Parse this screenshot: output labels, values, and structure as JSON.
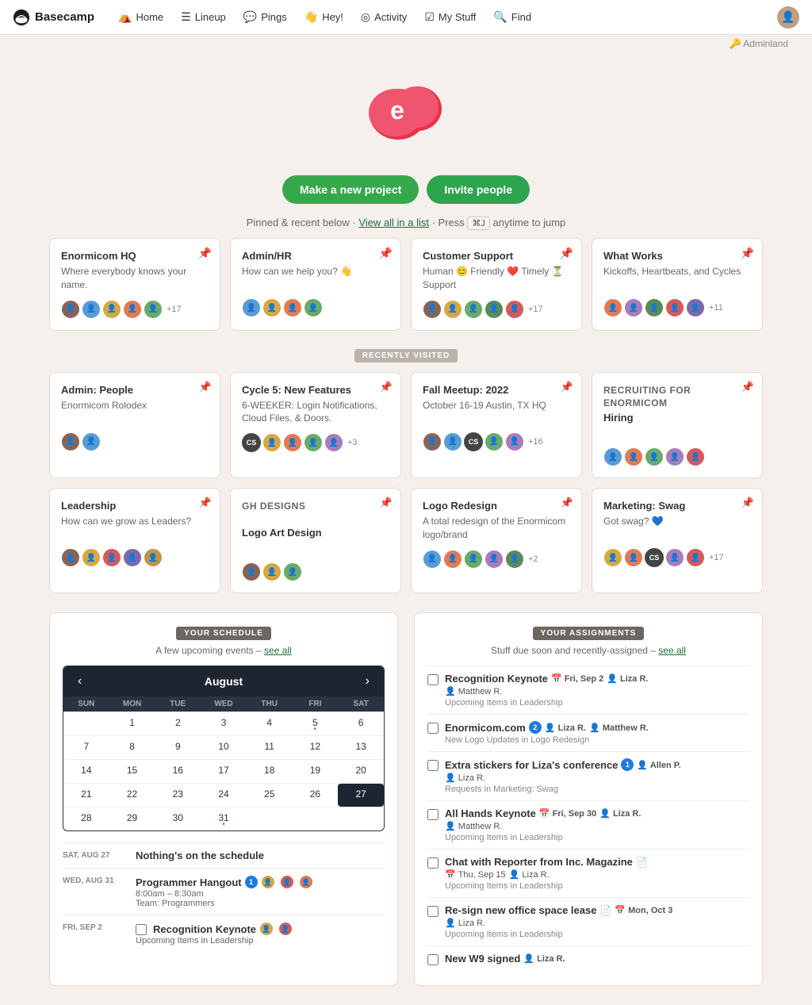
{
  "nav": {
    "brand": "Basecamp",
    "items": [
      {
        "label": "Home",
        "icon": "⛺"
      },
      {
        "label": "Lineup",
        "icon": "☰"
      },
      {
        "label": "Pings",
        "icon": "💬"
      },
      {
        "label": "Hey!",
        "icon": "👋"
      },
      {
        "label": "Activity",
        "icon": "◎"
      },
      {
        "label": "My Stuff",
        "icon": "☑"
      },
      {
        "label": "Find",
        "icon": "🔍"
      }
    ]
  },
  "adminland": "🔑 Adminland",
  "hero": {
    "subtitle_before": "Pinned & recent below · ",
    "view_all": "View all in a list",
    "subtitle_mid": " · Press ",
    "kbd": "⌘J",
    "subtitle_after": " anytime to jump",
    "btn_new": "Make a new project",
    "btn_invite": "Invite people"
  },
  "pinned_projects": [
    {
      "title": "Enormicom HQ",
      "desc": "Where everybody knows your name.",
      "pinned": true,
      "avatars": [
        "av1",
        "av2",
        "av3",
        "av4",
        "av5",
        "av6"
      ],
      "count": "+17"
    },
    {
      "title": "Admin/HR",
      "desc": "How can we help you? 👋",
      "pinned": true,
      "avatars": [
        "av2",
        "av3",
        "av4",
        "av5"
      ],
      "count": ""
    },
    {
      "title": "Customer Support",
      "desc": "Human 😊 Friendly ❤️ Timely ⏳ Support",
      "pinned": true,
      "avatars": [
        "av1",
        "av3",
        "av5",
        "av7",
        "av8",
        "av9"
      ],
      "count": "+17"
    },
    {
      "title": "What Works",
      "desc": "Kickoffs, Heartbeats, and Cycles",
      "pinned": true,
      "avatars": [
        "av4",
        "av6",
        "av7",
        "av8",
        "av9",
        "av10"
      ],
      "count": "+11"
    }
  ],
  "recently_visited_label": "RECENTLY VISITED",
  "recent_projects": [
    {
      "title": "Admin: People",
      "desc": "Enormicom Rolodex",
      "sub": "",
      "avatars": [
        "av1",
        "av2"
      ],
      "count": ""
    },
    {
      "title": "Cycle 5: New Features",
      "desc": "6-WEEKER: Login Notifications, Cloud Files, & Doors.",
      "sub": "",
      "avatars": [
        "cs",
        "av3",
        "av4",
        "av5",
        "av6",
        "av7"
      ],
      "count": "+3"
    },
    {
      "title": "Fall Meetup: 2022",
      "desc": "October 16-19 Austin, TX HQ",
      "sub": "",
      "avatars": [
        "av1",
        "av2",
        "cs",
        "av5",
        "av6",
        "av7"
      ],
      "count": "+16"
    },
    {
      "title": "Hiring",
      "desc": "",
      "sub": "RECRUITING FOR ENORMICOM",
      "avatars": [
        "av2",
        "av4",
        "av5",
        "av6",
        "av8"
      ],
      "count": ""
    },
    {
      "title": "Leadership",
      "desc": "How can we grow as Leaders?",
      "sub": "",
      "avatars": [
        "av1",
        "av3",
        "av8",
        "av9",
        "av10"
      ],
      "count": ""
    },
    {
      "title": "Logo Art Design",
      "desc": "",
      "sub": "GH DESIGNS",
      "avatars": [
        "av1",
        "av3",
        "av5"
      ],
      "count": ""
    },
    {
      "title": "Logo Redesign",
      "desc": "A total redesign of the Enormicom logo/brand",
      "sub": "",
      "avatars": [
        "av2",
        "av4",
        "av5",
        "av6",
        "av7",
        "av8"
      ],
      "count": "+2"
    },
    {
      "title": "Marketing: Swag",
      "desc": "Got swag? 💙",
      "sub": "",
      "avatars": [
        "av3",
        "av4",
        "cs",
        "av6",
        "av7",
        "av8"
      ],
      "count": "+17"
    }
  ],
  "schedule": {
    "badge": "YOUR SCHEDULE",
    "subtitle": "A few upcoming events –",
    "see_all": "see all",
    "calendar": {
      "month": "August",
      "days_header": [
        "SUN",
        "MON",
        "TUE",
        "WED",
        "THU",
        "FRI",
        "SAT"
      ],
      "weeks": [
        [
          "",
          "1",
          "2",
          "3",
          "4",
          "5",
          "6"
        ],
        [
          "7",
          "8",
          "9",
          "10",
          "11",
          "12",
          "13"
        ],
        [
          "14",
          "15",
          "16",
          "17",
          "18",
          "19",
          "20"
        ],
        [
          "21",
          "22",
          "23",
          "24",
          "25",
          "26",
          "27"
        ],
        [
          "28",
          "29",
          "30",
          "31",
          "",
          "",
          ""
        ]
      ],
      "today": "27",
      "dot_days": [
        "5",
        "31"
      ]
    },
    "items": [
      {
        "date": "SAT, AUG 27",
        "event": "Nothing's on the schedule",
        "sub": "",
        "badge": ""
      },
      {
        "date": "WED, AUG 31",
        "event": "Programmer Hangout",
        "badge": "1",
        "time": "8:00am – 8:30am",
        "sub": "Team: Programmers"
      },
      {
        "date": "FRI, SEP 2",
        "event": "Recognition Keynote",
        "badge": "",
        "time": "",
        "sub": "Upcoming Items in Leadership"
      }
    ]
  },
  "assignments": {
    "badge": "YOUR ASSIGNMENTS",
    "subtitle": "Stuff due soon and recently-assigned –",
    "see_all": "see all",
    "items": [
      {
        "title": "Recognition Keynote",
        "date": "Fri, Sep 2",
        "persons": [
          "Matthew R.",
          "Liza R."
        ],
        "sub": "Upcoming Items in Leadership",
        "num": ""
      },
      {
        "title": "Enormicom.com",
        "num": "2",
        "persons": [
          "Liza R.",
          "Matthew R."
        ],
        "sub": "New Logo Updates in Logo Redesign",
        "date": ""
      },
      {
        "title": "Extra stickers for Liza's conference",
        "num": "1",
        "persons": [
          "Allen P.",
          "Liza R."
        ],
        "sub": "Requests in Marketing: Swag",
        "date": ""
      },
      {
        "title": "All Hands Keynote",
        "date": "Fri, Sep 30",
        "persons": [
          "Liza R.",
          "Matthew R."
        ],
        "sub": "Upcoming Items in Leadership",
        "num": ""
      },
      {
        "title": "Chat with Reporter from Inc. Magazine",
        "date": "Thu, Sep 15",
        "persons": [
          "Liza R."
        ],
        "sub": "Upcoming Items in Leadership",
        "num": ""
      },
      {
        "title": "Re-sign new office space lease",
        "date": "Mon, Oct 3",
        "persons": [
          "Liza R."
        ],
        "sub": "Upcoming Items in Leadership",
        "num": ""
      },
      {
        "title": "New W9 signed",
        "date": "",
        "persons": [
          "Liza R."
        ],
        "sub": "",
        "num": ""
      }
    ]
  }
}
